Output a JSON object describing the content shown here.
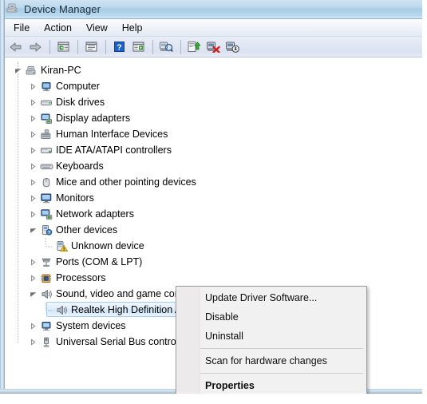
{
  "window": {
    "title": "Device Manager",
    "title_icon": "device-manager-icon"
  },
  "menubar": {
    "items": [
      {
        "label": "File",
        "name": "menu-file"
      },
      {
        "label": "Action",
        "name": "menu-action"
      },
      {
        "label": "View",
        "name": "menu-view"
      },
      {
        "label": "Help",
        "name": "menu-help"
      }
    ]
  },
  "toolbar": {
    "buttons": [
      {
        "icon": "back-arrow-icon",
        "tooltip": "Back"
      },
      {
        "icon": "forward-arrow-icon",
        "tooltip": "Forward"
      },
      {
        "icon": "show-hide-console-tree-icon",
        "tooltip": "Show/Hide Console Tree"
      },
      {
        "icon": "properties-icon",
        "tooltip": "Properties"
      },
      {
        "icon": "help-icon",
        "tooltip": "Help"
      },
      {
        "icon": "show-hide-action-pane-icon",
        "tooltip": "Show/Hide Action Pane"
      },
      {
        "icon": "scan-for-hardware-changes-icon",
        "tooltip": "Scan for hardware changes"
      },
      {
        "icon": "update-driver-software-icon",
        "tooltip": "Update Driver Software"
      },
      {
        "icon": "uninstall-icon",
        "tooltip": "Uninstall"
      },
      {
        "icon": "disable-icon",
        "tooltip": "Disable"
      }
    ]
  },
  "tree": {
    "nodes": [
      {
        "label": "Kiran-PC",
        "level": 0,
        "state": "expanded",
        "icon": "computer-root-icon",
        "name": "tree-node-kiran-pc"
      },
      {
        "label": "Computer",
        "level": 1,
        "state": "collapsed",
        "icon": "computer-icon",
        "name": "tree-node-computer"
      },
      {
        "label": "Disk drives",
        "level": 1,
        "state": "collapsed",
        "icon": "disk-drive-icon",
        "name": "tree-node-disk-drives"
      },
      {
        "label": "Display adapters",
        "level": 1,
        "state": "collapsed",
        "icon": "display-adapter-icon",
        "name": "tree-node-display-adapters"
      },
      {
        "label": "Human Interface Devices",
        "level": 1,
        "state": "collapsed",
        "icon": "hid-icon",
        "name": "tree-node-human-interface-devices"
      },
      {
        "label": "IDE ATA/ATAPI controllers",
        "level": 1,
        "state": "collapsed",
        "icon": "ide-controller-icon",
        "name": "tree-node-ide-ata-atapi-controllers"
      },
      {
        "label": "Keyboards",
        "level": 1,
        "state": "collapsed",
        "icon": "keyboard-icon",
        "name": "tree-node-keyboards"
      },
      {
        "label": "Mice and other pointing devices",
        "level": 1,
        "state": "collapsed",
        "icon": "mouse-icon",
        "name": "tree-node-mice-and-other-pointing-devices"
      },
      {
        "label": "Monitors",
        "level": 1,
        "state": "collapsed",
        "icon": "monitor-icon",
        "name": "tree-node-monitors"
      },
      {
        "label": "Network adapters",
        "level": 1,
        "state": "collapsed",
        "icon": "network-adapter-icon",
        "name": "tree-node-network-adapters"
      },
      {
        "label": "Other devices",
        "level": 1,
        "state": "expanded",
        "icon": "other-device-icon",
        "name": "tree-node-other-devices"
      },
      {
        "label": "Unknown device",
        "level": 2,
        "state": "leaf",
        "icon": "unknown-device-warning-icon",
        "name": "tree-node-unknown-device"
      },
      {
        "label": "Ports (COM & LPT)",
        "level": 1,
        "state": "collapsed",
        "icon": "port-icon",
        "name": "tree-node-ports-com-lpt"
      },
      {
        "label": "Processors",
        "level": 1,
        "state": "collapsed",
        "icon": "processor-icon",
        "name": "tree-node-processors"
      },
      {
        "label": "Sound, video and game controllers",
        "level": 1,
        "state": "expanded",
        "icon": "sound-controller-icon",
        "name": "tree-node-sound-video-and-game-controllers"
      },
      {
        "label": "Realtek High Definition Audio",
        "level": 2,
        "state": "leaf",
        "icon": "sound-device-icon",
        "name": "tree-node-realtek-high-definition-audio",
        "selected": true
      },
      {
        "label": "System devices",
        "level": 1,
        "state": "collapsed",
        "icon": "system-device-icon",
        "name": "tree-node-system-devices"
      },
      {
        "label": "Universal Serial Bus controllers",
        "level": 1,
        "state": "collapsed",
        "icon": "usb-controller-icon",
        "name": "tree-node-universal-serial-bus-controllers"
      }
    ]
  },
  "context_menu": {
    "items": [
      {
        "label": "Update Driver Software...",
        "type": "item",
        "bold": false,
        "name": "ctx-update-driver-software"
      },
      {
        "label": "Disable",
        "type": "item",
        "bold": false,
        "name": "ctx-disable"
      },
      {
        "label": "Uninstall",
        "type": "item",
        "bold": false,
        "name": "ctx-uninstall"
      },
      {
        "type": "separator"
      },
      {
        "label": "Scan for hardware changes",
        "type": "item",
        "bold": false,
        "name": "ctx-scan-for-hardware-changes"
      },
      {
        "type": "separator"
      },
      {
        "label": "Properties",
        "type": "item",
        "bold": true,
        "name": "ctx-properties"
      }
    ]
  },
  "colors": {
    "titlebar": "#bcd9ee",
    "toolbar": "#e2e7f4",
    "selection_fill": "#d2e7fa",
    "selection_border": "#a6cdee",
    "menu_background": "#f1f1f1",
    "warning_yellow": "#f5c518"
  }
}
